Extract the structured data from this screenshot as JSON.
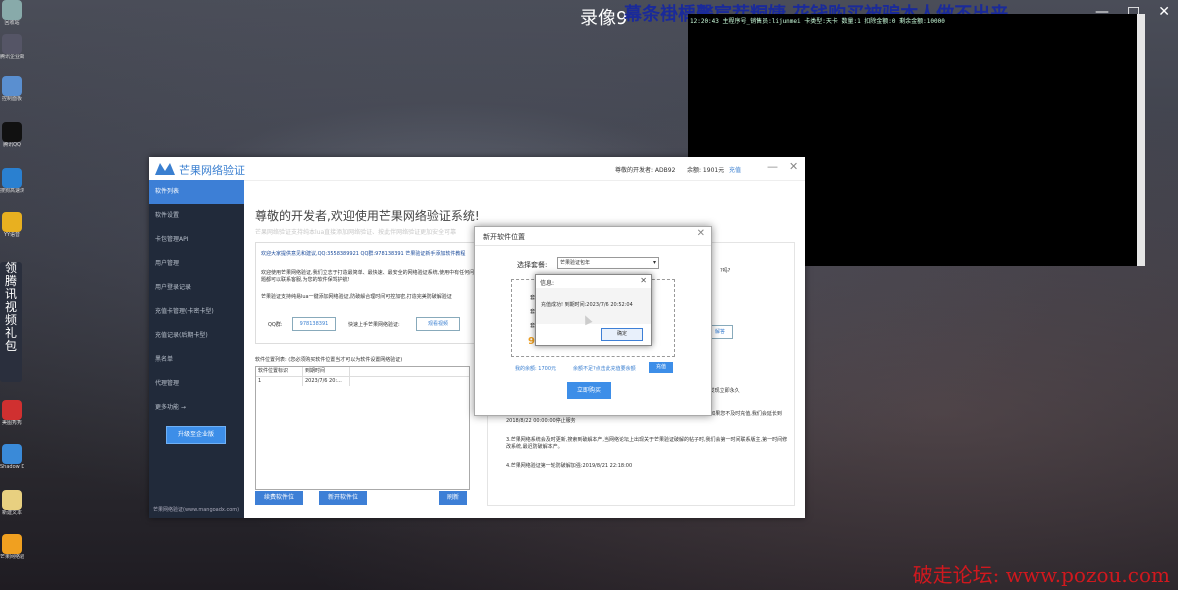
{
  "recorder": {
    "title": "录像9",
    "overlay_text": "幕条褂楀毊宸茬粡婕  花钱购买被骗本人做不出来",
    "window_controls": [
      "—",
      "□",
      "✕"
    ]
  },
  "console": {
    "line": "12:20:43  主程序号_销售员:lijunmei 卡类型:天卡 数量:1 扣除金额:0 剩余金额:10000"
  },
  "watermark": "破走论坛: www.pozou.com",
  "desktop": {
    "icons": [
      {
        "label": "回收站",
        "color": "#8aa"
      },
      {
        "label": "腾讯企业邮",
        "color": "#556"
      },
      {
        "label": "控制面板",
        "color": "#5a8fd0"
      },
      {
        "label": "腾讯QQ",
        "color": "#111"
      },
      {
        "label": "搜狗高速浏览器",
        "color": "#2a80d0"
      },
      {
        "label": "YY语音",
        "color": "#e8b020"
      },
      {
        "label": "美图秀秀",
        "color": "#d03030"
      },
      {
        "label": "Shadow Defender",
        "color": "#3a8ad8"
      },
      {
        "label": "新建文本",
        "color": "#e8d080"
      },
      {
        "label": "芒果网络验证",
        "color": "#f0a020"
      }
    ],
    "vertical_text": "领腾讯视频礼包"
  },
  "app": {
    "name": "芒果网络验证",
    "header": {
      "developer": "尊敬的开发者: ADB92",
      "balance": "余额: 1901元",
      "recharge": "充值",
      "minimize": "—",
      "close": "✕"
    },
    "sidebar": {
      "items": [
        "软件列表",
        "软件设置",
        "卡包管理API",
        "用户管理",
        "用户登录记录",
        "充值卡管理(卡密卡型)",
        "充值记录(后期卡型)",
        "黑名单",
        "代理管理",
        "更多功能 →"
      ],
      "upgrade": "升级至企业版",
      "footer": "芒果网络验证(www.mangoadx.com)"
    },
    "welcome": "尊敬的开发者,欢迎使用芒果网络验证系统!",
    "subline": "芒果网络验证支持纯本lua直接添加网络验证、按此伴网络验证更加安全可靠",
    "notice": {
      "line1": "欢迎大家提供意见和建议,QQ:3558389921 QQ群:978138391 芒果验证新手添加软件教程",
      "line2": "欢迎使用芒果网络验证,我们立志于打造最简单、最快速、最安全的网络验证系统,使用中有任何问题都可以联系客服,为您的软件保驾护航!",
      "line3": "芒果验证支持纯易lua一键添加网络验证,防破解合理时间可控加密,打造完美防破解验证",
      "qq_label": "QQ群:",
      "qq_value": "978138391",
      "fast_label": "快速上手芒果网络验证:",
      "video_btn": "观看视频"
    },
    "list_title": "软件位置列表: (您必须购买软件位置当才可以为软件设置网络验证)",
    "grid": {
      "headers": [
        "软件位置标识",
        "到期时间"
      ],
      "rows": [
        [
          "1",
          "2023/7/6 20:..."
        ]
      ]
    },
    "buttons": {
      "renew": "续费软件位",
      "new_slot": "新开软件位",
      "refresh": "刷新"
    },
    "right_panel": {
      "question": "?吗?",
      "answer_btn": "解答",
      "para1": "程序使用,发现立即永久",
      "para2": "2.芒果网络验证已进行升级,所有用户均送一个月的到期软件位置2018/8/21 11:03:52 到期,如果您不及时充值,我们会延长到2018/8/22 00:00:00停止服务",
      "para3": "3.芒果网络系统会及时更新,搜索到破解本产,当网络论坛上出现关于芒果验证破解的帖子时,我们会第一时间联系版主,第一时间修改系统,最迟防破解本产。",
      "para4": "4.芒果网络验证第一轮防破解加强:2019/8/21 22:18:00"
    }
  },
  "dialog": {
    "title": "新开软件位置",
    "close": "✕",
    "package_label": "选择套餐:",
    "package_value": "芒果验证包年",
    "box_lines": [
      "套餐",
      "套餐",
      "套餐"
    ],
    "price": "99",
    "balance": "我的余额: 1700元",
    "balance_note": "余额不足?点击此充值要余额",
    "recharge": "充值",
    "buy": "立即购买"
  },
  "message": {
    "title": "信息:",
    "close": "✕",
    "text": "充值成功! 到期时间:2023/7/6 20:52:04",
    "ok": "确定"
  }
}
